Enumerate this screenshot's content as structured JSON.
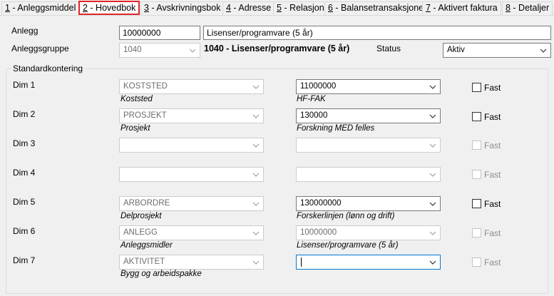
{
  "tabs": [
    {
      "key": "1",
      "label": " - Anleggsmiddel"
    },
    {
      "key": "2",
      "label": " - Hovedbok"
    },
    {
      "key": "3",
      "label": " - Avskrivningsbok"
    },
    {
      "key": "4",
      "label": " - Adresse"
    },
    {
      "key": "5",
      "label": " - Relasjon"
    },
    {
      "key": "6",
      "label": " - Balansetransaksjoner"
    },
    {
      "key": "7",
      "label": " - Aktivert faktura"
    },
    {
      "key": "8",
      "label": " - Detaljer"
    }
  ],
  "header": {
    "anlegg_label": "Anlegg",
    "anlegg_value": "10000000",
    "anlegg_desc": "Lisenser/programvare (5 år)",
    "gruppe_label": "Anleggsgruppe",
    "gruppe_value": "1040",
    "gruppe_desc": "1040 - Lisenser/programvare (5 år)",
    "status_label": "Status",
    "status_value": "Aktiv"
  },
  "standard": {
    "title": "Standardkontering",
    "fast_label": "Fast",
    "rows": [
      {
        "label": "Dim 1",
        "dim": "KOSTSTED",
        "dim_desc": "Koststed",
        "value": "11000000",
        "value_desc": "HF-FAK"
      },
      {
        "label": "Dim 2",
        "dim": "PROSJEKT",
        "dim_desc": "Prosjekt",
        "value": "130000",
        "value_desc": "Forskning MED felles"
      },
      {
        "label": "Dim 3",
        "dim": "",
        "dim_desc": "",
        "value": "",
        "value_desc": ""
      },
      {
        "label": "Dim 4",
        "dim": "",
        "dim_desc": "",
        "value": "",
        "value_desc": ""
      },
      {
        "label": "Dim 5",
        "dim": "ARBORDRE",
        "dim_desc": "Delprosjekt",
        "value": "130000000",
        "value_desc": "Forskerlinjen (lønn og drift)"
      },
      {
        "label": "Dim 6",
        "dim": "ANLEGG",
        "dim_desc": "Anleggsmidler",
        "value": "10000000",
        "value_desc": "Lisenser/programvare (5 år)"
      },
      {
        "label": "Dim 7",
        "dim": "AKTIVITET",
        "dim_desc": "Bygg og arbeidspakke",
        "value": "",
        "value_desc": ""
      }
    ]
  }
}
